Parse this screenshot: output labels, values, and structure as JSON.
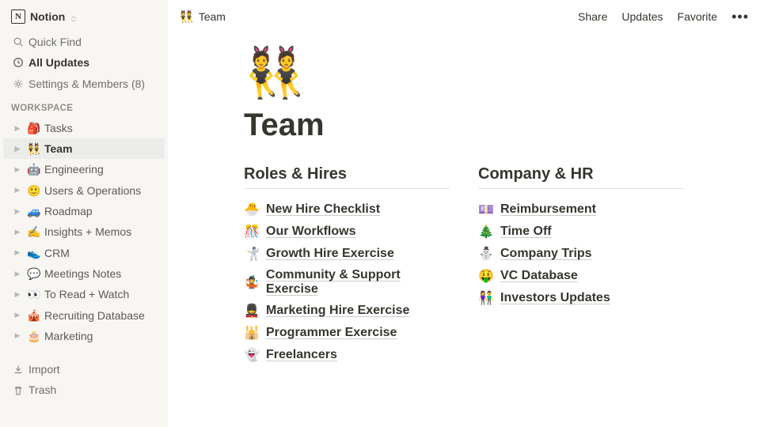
{
  "workspace": {
    "name": "Notion"
  },
  "sidebar": {
    "quick_find": "Quick Find",
    "all_updates": "All Updates",
    "settings_members": "Settings & Members (8)",
    "section_label": "WORKSPACE",
    "items": [
      {
        "emoji": "🎒",
        "label": "Tasks"
      },
      {
        "emoji": "👯",
        "label": "Team"
      },
      {
        "emoji": "🤖",
        "label": "Engineering"
      },
      {
        "emoji": "🙂",
        "label": "Users & Operations"
      },
      {
        "emoji": "🚙",
        "label": "Roadmap"
      },
      {
        "emoji": "✍️",
        "label": "Insights + Memos"
      },
      {
        "emoji": "👟",
        "label": "CRM"
      },
      {
        "emoji": "💬",
        "label": "Meetings Notes"
      },
      {
        "emoji": "👀",
        "label": "To Read + Watch"
      },
      {
        "emoji": "🎪",
        "label": "Recruiting Database"
      },
      {
        "emoji": "🎂",
        "label": "Marketing"
      }
    ],
    "import": "Import",
    "trash": "Trash"
  },
  "topbar": {
    "breadcrumb_emoji": "👯",
    "breadcrumb_label": "Team",
    "actions": {
      "share": "Share",
      "updates": "Updates",
      "favorite": "Favorite"
    }
  },
  "page": {
    "icon": "👯",
    "title": "Team",
    "columns": [
      {
        "heading": "Roles & Hires",
        "items": [
          {
            "emoji": "🐣",
            "label": "New Hire Checklist"
          },
          {
            "emoji": "🎊",
            "label": "Our Workflows"
          },
          {
            "emoji": "🤺",
            "label": "Growth Hire Exercise"
          },
          {
            "emoji": "🤹",
            "label": "Community & Support Exercise"
          },
          {
            "emoji": "💂",
            "label": "Marketing Hire Exercise"
          },
          {
            "emoji": "🕌",
            "label": "Programmer Exercise"
          },
          {
            "emoji": "👻",
            "label": "Freelancers"
          }
        ]
      },
      {
        "heading": "Company & HR",
        "items": [
          {
            "emoji": "💷",
            "label": "Reimbursement"
          },
          {
            "emoji": "🎄",
            "label": "Time Off"
          },
          {
            "emoji": "⛄",
            "label": "Company Trips"
          },
          {
            "emoji": "🤑",
            "label": "VC Database"
          },
          {
            "emoji": "👫",
            "label": "Investors Updates"
          }
        ]
      }
    ]
  }
}
